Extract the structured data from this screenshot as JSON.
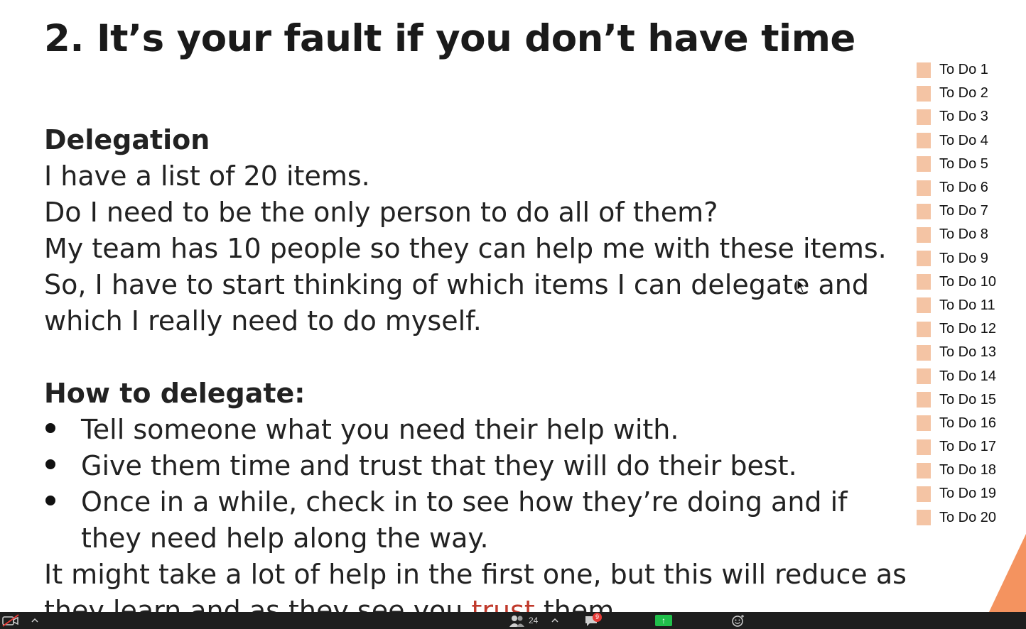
{
  "slide": {
    "title": "2. It’s your fault if you don’t have time",
    "delegation": {
      "heading": "Delegation",
      "lines": [
        "I have a list of 20 items.",
        "Do I need to be the only person to do all of them?",
        "My team has 10 people so they can help me with these items.",
        "So, I have to start thinking of which items I can delegate and",
        "which I really need to do myself."
      ]
    },
    "how_to": {
      "heading": "How to delegate:",
      "bullets": [
        "Tell someone what you need their help with.",
        "Give them time and trust that they will do their best.",
        "Once in a while, check in to see how they’re doing and if they need help along the way."
      ],
      "closing_line": "It might take a lot of help in the first one, but this will reduce as",
      "closing_line_2_prefix": "they learn and as they see you ",
      "closing_line_2_highlight": "trust",
      "closing_line_2_suffix": " them."
    },
    "todos": [
      "To Do 1",
      "To Do 2",
      "To Do 3",
      "To Do 4",
      "To Do 5",
      "To Do 6",
      "To Do 7",
      "To Do 8",
      "To Do 9",
      "To Do 10",
      "To Do 11",
      "To Do 12",
      "To Do 13",
      "To Do 14",
      "To Do 15",
      "To Do 16",
      "To Do 17",
      "To Do 18",
      "To Do 19",
      "To Do 20"
    ],
    "colors": {
      "todo_box": "#f4c4a4",
      "accent_corner": "#f4935f",
      "highlight_text": "#c0392b"
    }
  },
  "taskbar": {
    "participants_count": "24",
    "chat_badge": "9",
    "icons": [
      "video-off-icon",
      "caret-up-icon",
      "participants-icon",
      "caret-up-icon",
      "chat-icon",
      "share-screen-icon",
      "reactions-icon"
    ]
  }
}
